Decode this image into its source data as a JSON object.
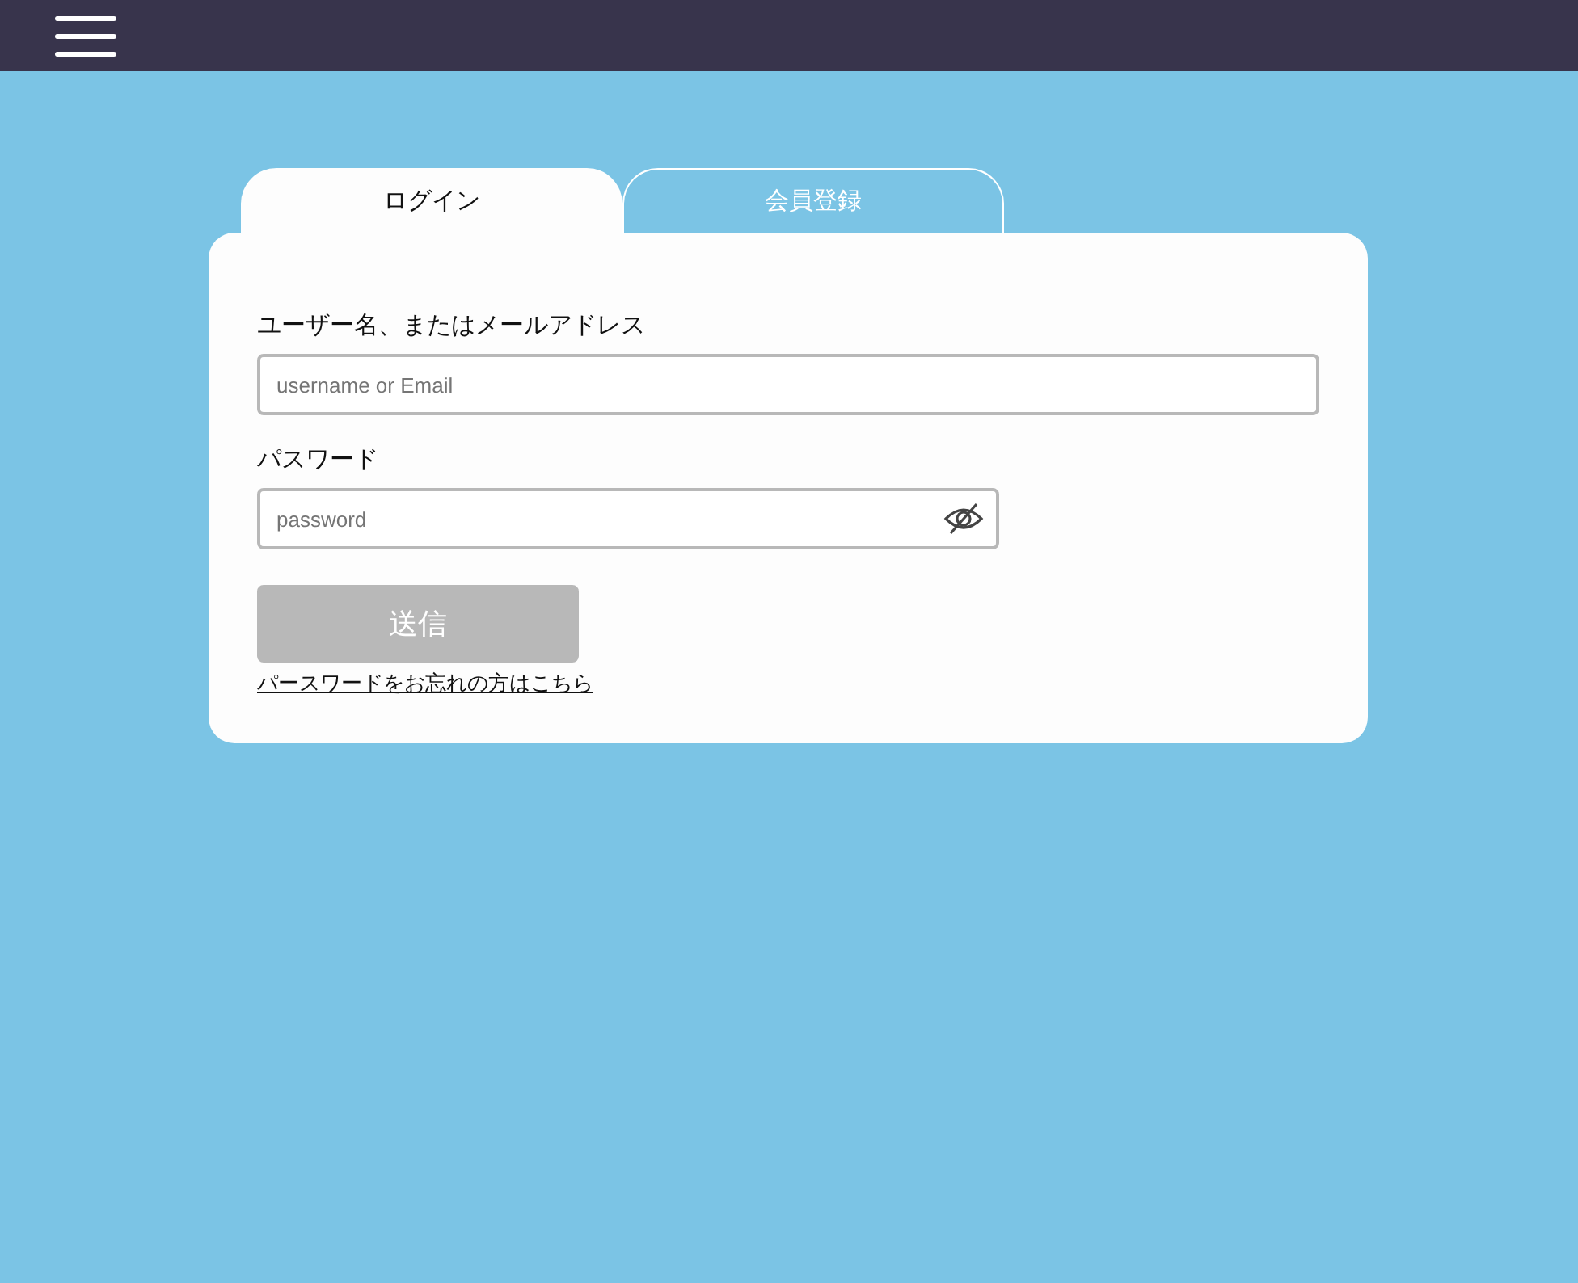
{
  "tabs": [
    {
      "label": "ログイン",
      "selected": true
    },
    {
      "label": "会員登録",
      "selected": false
    }
  ],
  "form": {
    "fields": [
      {
        "label": "ユーザー名、またはメールアドレス",
        "placeholder": "username or Email",
        "kind": "text"
      },
      {
        "label": "パスワード",
        "placeholder": "password",
        "kind": "password"
      }
    ],
    "submit": {
      "label": "送信",
      "disabled": true
    },
    "forgot_link": "パースワードをお忘れの方はこちら"
  }
}
